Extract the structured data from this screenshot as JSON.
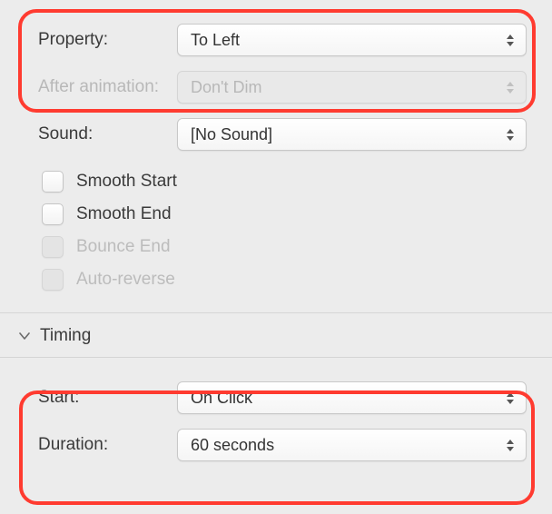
{
  "properties": {
    "property_label": "Property:",
    "property_value": "To Left",
    "after_animation_label": "After animation:",
    "after_animation_value": "Don't Dim",
    "sound_label": "Sound:",
    "sound_value": "[No Sound]"
  },
  "checkboxes": {
    "smooth_start": "Smooth Start",
    "smooth_end": "Smooth End",
    "bounce_end": "Bounce End",
    "auto_reverse": "Auto-reverse"
  },
  "timing": {
    "section_title": "Timing",
    "start_label": "Start:",
    "start_value": "On Click",
    "duration_label": "Duration:",
    "duration_value": "60 seconds"
  }
}
